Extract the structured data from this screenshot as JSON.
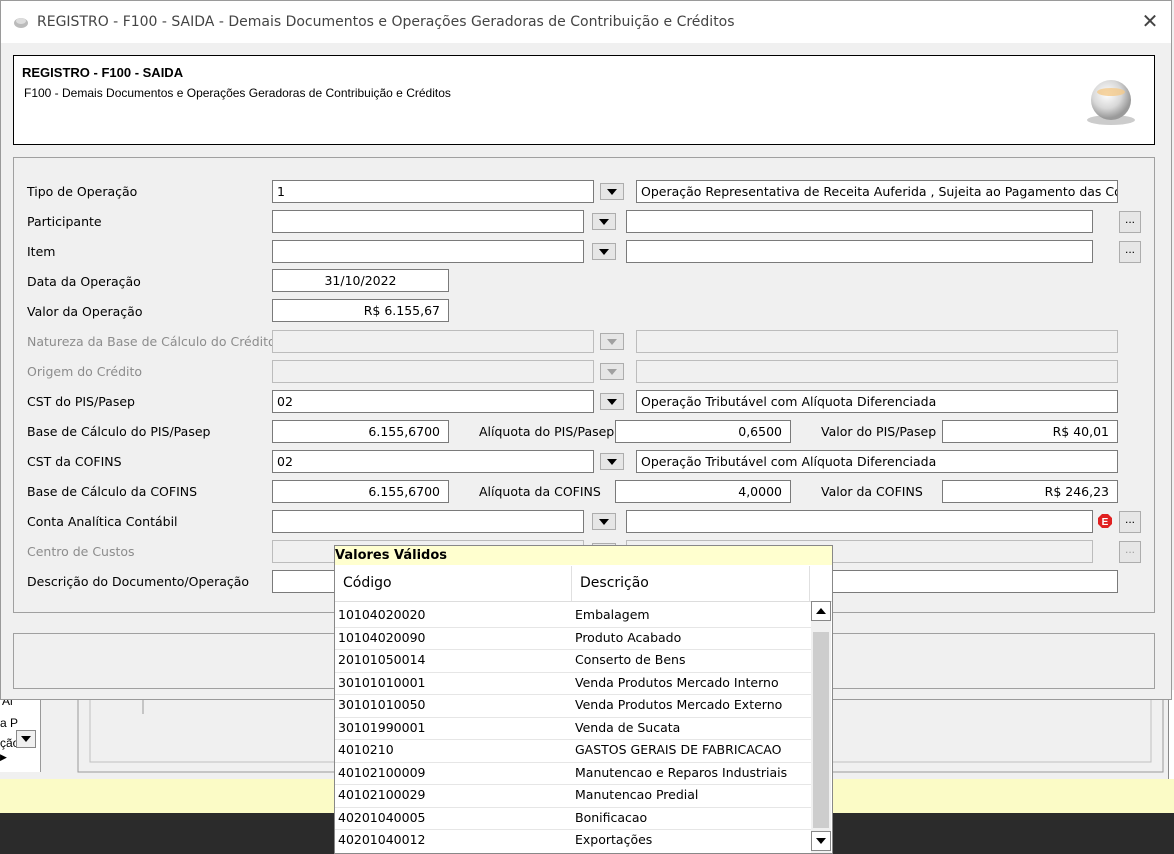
{
  "window": {
    "title": "REGISTRO - F100 - SAIDA - Demais Documentos e Operações Geradoras de Contribuição e Créditos",
    "close_label": "✕"
  },
  "header": {
    "title": "REGISTRO - F100 - SAIDA",
    "subtitle": "F100 - Demais Documentos e Operações Geradoras de Contribuição e Créditos"
  },
  "form": {
    "tipo_operacao": {
      "label": "Tipo de Operação",
      "value": "1",
      "description": "Operação Representativa de Receita Auferida , Sujeita  ao Pagamento das Cor"
    },
    "participante": {
      "label": "Participante",
      "value": "",
      "description": "",
      "browse": "..."
    },
    "item": {
      "label": "Item",
      "value": "",
      "description": "",
      "browse": "..."
    },
    "data_operacao": {
      "label": "Data da Operação",
      "value": "31/10/2022"
    },
    "valor_operacao": {
      "label": "Valor da Operação",
      "value": "R$ 6.155,67"
    },
    "natureza_base": {
      "label": "Natureza da Base de Cálculo do Crédito",
      "value": "",
      "description": ""
    },
    "origem_credito": {
      "label": "Origem do Crédito",
      "value": "",
      "description": ""
    },
    "cst_pis": {
      "label": "CST do PIS/Pasep",
      "value": "02",
      "description": "Operação Tributável com Alíquota Diferenciada"
    },
    "base_pis": {
      "label": "Base de Cálculo do PIS/Pasep",
      "value": "6.155,6700",
      "aliquota_label": "Alíquota do PIS/Pasep",
      "aliquota": "0,6500",
      "valor_label": "Valor do PIS/Pasep",
      "valor": "R$ 40,01"
    },
    "cst_cofins": {
      "label": "CST da COFINS",
      "value": "02",
      "description": "Operação Tributável com Alíquota Diferenciada"
    },
    "base_cofins": {
      "label": "Base de Cálculo da COFINS",
      "value": "6.155,6700",
      "aliquota_label": "Alíquota da COFINS",
      "aliquota": "4,0000",
      "valor_label": "Valor da COFINS",
      "valor": "R$ 246,23"
    },
    "conta_analitica": {
      "label": "Conta Analítica Contábil",
      "value": "",
      "description": "",
      "browse": "..."
    },
    "centro_custos": {
      "label": "Centro de Custos",
      "value": "",
      "description": "",
      "browse": "..."
    },
    "descricao_doc": {
      "label": "Descrição do Documento/Operação",
      "value": ""
    }
  },
  "popup": {
    "title": "Valores Válidos",
    "col_codigo": "Código",
    "col_descricao": "Descrição",
    "rows": [
      {
        "codigo": "10104020020",
        "descricao": "Embalagem"
      },
      {
        "codigo": "10104020090",
        "descricao": "Produto Acabado"
      },
      {
        "codigo": "20101050014",
        "descricao": "Conserto de Bens"
      },
      {
        "codigo": "30101010001",
        "descricao": "Venda Produtos Mercado Interno"
      },
      {
        "codigo": "30101010050",
        "descricao": "Venda Produtos Mercado Externo"
      },
      {
        "codigo": "30101990001",
        "descricao": "Venda de Sucata"
      },
      {
        "codigo": "4010210",
        "descricao": "GASTOS GERAIS DE FABRICACAO"
      },
      {
        "codigo": "40102100009",
        "descricao": "Manutencao e Reparos  Industriais"
      },
      {
        "codigo": "40102100029",
        "descricao": "Manutencao Predial"
      },
      {
        "codigo": "40201040005",
        "descricao": "Bonificacao"
      },
      {
        "codigo": "40201040012",
        "descricao": "Exportações"
      }
    ]
  },
  "background": {
    "left_labels": [
      "Al",
      "a P",
      "ção"
    ]
  }
}
